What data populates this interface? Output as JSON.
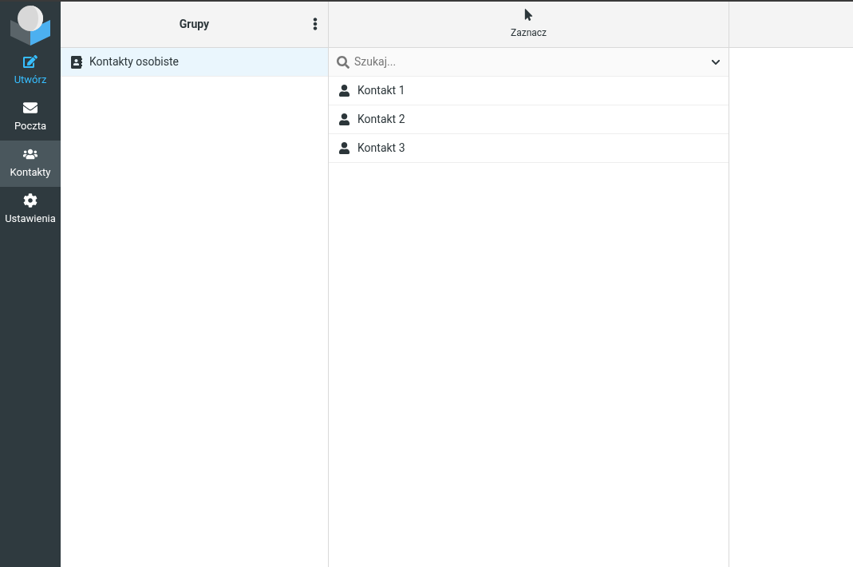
{
  "nav": [
    {
      "kind": "compose",
      "label": "Utwórz",
      "selected": false
    },
    {
      "kind": "mail",
      "label": "Poczta",
      "selected": false
    },
    {
      "kind": "contacts",
      "label": "Kontakty",
      "selected": true
    },
    {
      "kind": "settings",
      "label": "Ustawienia",
      "selected": false
    }
  ],
  "groups": {
    "title": "Grupy",
    "items": [
      {
        "label": "Kontakty osobiste",
        "selected": true
      }
    ]
  },
  "contacts": {
    "toolbar_label": "Zaznacz",
    "search": {
      "placeholder": "Szukaj..."
    },
    "items": [
      {
        "label": "Kontakt 1",
        "selected": false
      },
      {
        "label": "Kontakt 2",
        "selected": false
      },
      {
        "label": "Kontakt 3",
        "selected": false
      }
    ]
  }
}
